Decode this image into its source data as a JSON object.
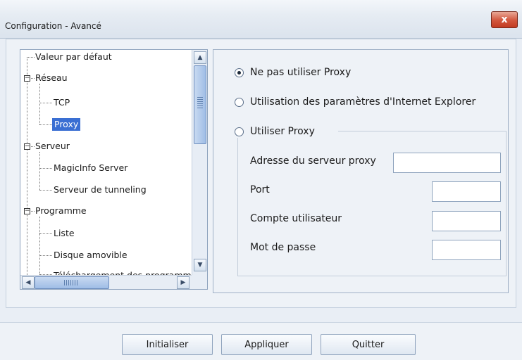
{
  "window": {
    "title": "Configuration - Avancé",
    "close_label": "x"
  },
  "tree": {
    "items": [
      {
        "label": "Valeur par défaut",
        "level": 0
      },
      {
        "label": "Réseau",
        "level": 0,
        "expanded": true,
        "toggle": "−"
      },
      {
        "label": "TCP",
        "level": 1
      },
      {
        "label": "Proxy",
        "level": 1,
        "selected": true
      },
      {
        "label": "Serveur",
        "level": 0,
        "expanded": true,
        "toggle": "−"
      },
      {
        "label": "MagicInfo Server",
        "level": 1
      },
      {
        "label": "Serveur de tunneling",
        "level": 1
      },
      {
        "label": "Programme",
        "level": 0,
        "expanded": true,
        "toggle": "−"
      },
      {
        "label": "Liste",
        "level": 1
      },
      {
        "label": "Disque amovible",
        "level": 1
      },
      {
        "label": "Téléchargement des programmes",
        "level": 1
      }
    ]
  },
  "proxy": {
    "options": [
      {
        "label": "Ne pas utiliser Proxy",
        "checked": true
      },
      {
        "label": "Utilisation des paramètres d'Internet Explorer",
        "checked": false
      },
      {
        "label": "Utiliser Proxy",
        "checked": false
      }
    ],
    "fields": [
      {
        "label": "Adresse du serveur proxy",
        "value": ""
      },
      {
        "label": "Port",
        "value": ""
      },
      {
        "label": "Compte utilisateur",
        "value": ""
      },
      {
        "label": "Mot de passe",
        "value": ""
      }
    ]
  },
  "buttons": {
    "reset": "Initialiser",
    "apply": "Appliquer",
    "quit": "Quitter"
  },
  "colors": {
    "selection": "#3a6fd3",
    "close": "#c23b22",
    "background": "#e9eef5"
  }
}
